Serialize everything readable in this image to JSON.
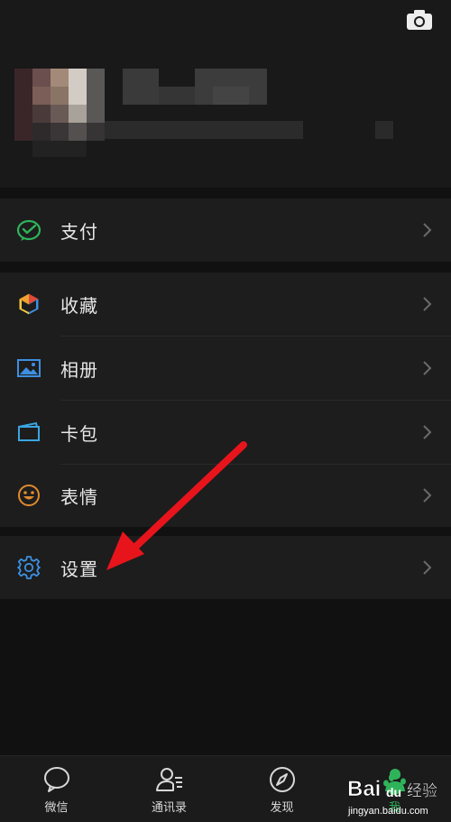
{
  "header": {
    "camera_icon": "camera-icon"
  },
  "groups": {
    "pay": [
      {
        "name": "pay",
        "label": "支付",
        "icon": "wechat-pay-icon",
        "color": "#2fb35a"
      }
    ],
    "main": [
      {
        "name": "favorites",
        "label": "收藏",
        "icon": "cube-icon"
      },
      {
        "name": "album",
        "label": "相册",
        "icon": "image-icon",
        "color": "#3d8fe0"
      },
      {
        "name": "cards",
        "label": "卡包",
        "icon": "wallet-icon",
        "color": "#3aa5e0"
      },
      {
        "name": "stickers",
        "label": "表情",
        "icon": "smiley-icon",
        "color": "#e08a2e"
      }
    ],
    "settings": [
      {
        "name": "settings",
        "label": "设置",
        "icon": "gear-icon",
        "color": "#3d8fe0"
      }
    ]
  },
  "tabs": [
    {
      "name": "chats",
      "label": "微信",
      "icon": "chat-bubble-icon"
    },
    {
      "name": "contacts",
      "label": "通讯录",
      "icon": "contacts-icon"
    },
    {
      "name": "discover",
      "label": "发现",
      "icon": "compass-icon"
    },
    {
      "name": "me",
      "label": "我",
      "icon": "person-icon"
    }
  ],
  "watermark": {
    "brand": "Bai du 经验",
    "url": "jingyan.baidu.com"
  }
}
